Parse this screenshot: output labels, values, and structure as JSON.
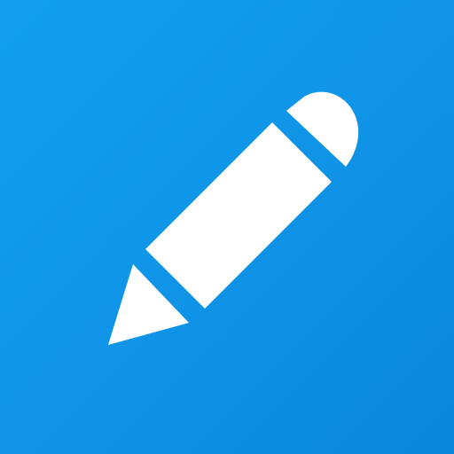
{
  "app": {
    "icon": "pencil-icon",
    "background_color": "#1298e8",
    "glyph_color": "#ffffff"
  }
}
